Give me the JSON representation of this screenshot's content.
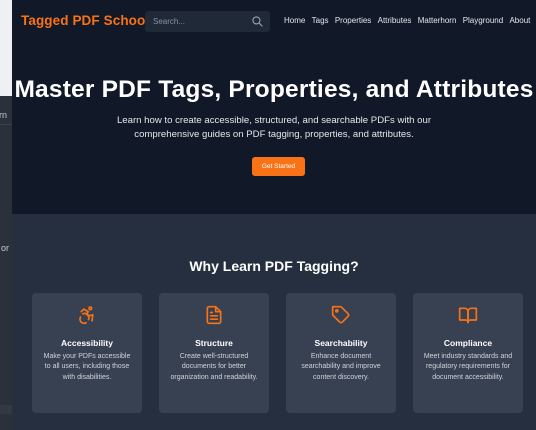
{
  "background_window": {
    "fragment_top": "orn",
    "fragment_mid": ", or"
  },
  "header": {
    "logo": "Tagged PDF School",
    "search_placeholder": "Search...",
    "nav": [
      "Home",
      "Tags",
      "Properties",
      "Attributes",
      "Matterhorn",
      "Playground",
      "About"
    ]
  },
  "hero": {
    "title": "Master PDF Tags, Properties, and Attributes",
    "subtitle": "Learn how to create accessible, structured, and searchable PDFs with our comprehensive guides on PDF tagging, properties, and attributes.",
    "cta": "Get Started"
  },
  "why": {
    "heading": "Why Learn PDF Tagging?",
    "cards": [
      {
        "icon": "accessibility-icon",
        "title": "Accessibility",
        "desc": "Make your PDFs accessible to all users, including those with disabilities."
      },
      {
        "icon": "document-icon",
        "title": "Structure",
        "desc": "Create well-structured documents for better organization and readability."
      },
      {
        "icon": "tag-icon",
        "title": "Searchability",
        "desc": "Enhance document searchability and improve content discovery."
      },
      {
        "icon": "book-icon",
        "title": "Compliance",
        "desc": "Meet industry standards and regulatory requirements for document accessibility."
      }
    ]
  },
  "colors": {
    "accent": "#f97316",
    "header_bg": "#111827",
    "section_bg": "#252f3f",
    "card_bg": "#374151"
  }
}
